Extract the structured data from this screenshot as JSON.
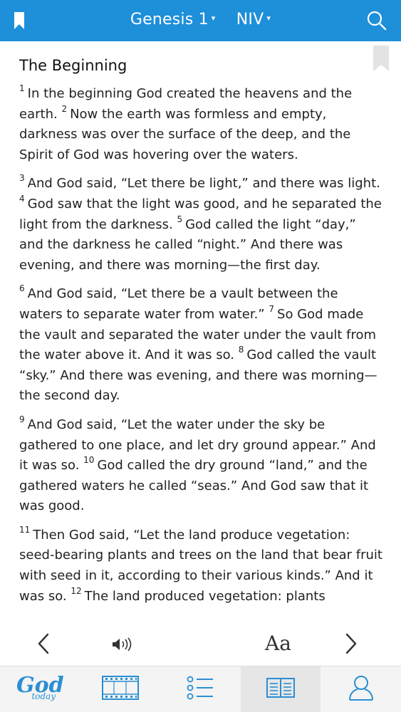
{
  "header": {
    "book": "Genesis 1",
    "version": "NIV",
    "book_caret": "▾",
    "version_caret": "▾",
    "bookmark_icon": "bookmark-icon",
    "search_icon": "search-icon",
    "bar_color": "#1e8fd9"
  },
  "reader": {
    "heading": "The Beginning",
    "paragraphs": [
      {
        "verses": [
          {
            "num": "1",
            "text": "In the beginning God created the heavens and the earth."
          },
          {
            "num": "2",
            "text": "Now the earth was formless and empty, darkness was over the surface of the deep, and the Spirit of God was hovering over the waters."
          }
        ]
      },
      {
        "verses": [
          {
            "num": "3",
            "text": "And God said, “Let there be light,” and there was light."
          },
          {
            "num": "4",
            "text": "God saw that the light was good, and he separated the light from the darkness."
          },
          {
            "num": "5",
            "text": "God called the light “day,” and the darkness he called “night.” And there was evening, and there was morning—the first day."
          }
        ]
      },
      {
        "verses": [
          {
            "num": "6",
            "text": "And God said, “Let there be a vault between the waters to separate water from water.”"
          },
          {
            "num": "7",
            "text": "So God made the vault and separated the water under the vault from the water above it. And it was so."
          },
          {
            "num": "8",
            "text": "God called the vault “sky.” And there was evening, and there was morning—the second day."
          }
        ]
      },
      {
        "verses": [
          {
            "num": "9",
            "text": "And God said, “Let the water under the sky be gathered to one place, and let dry ground appear.” And it was so."
          },
          {
            "num": "10",
            "text": "God called the dry ground “land,” and the gathered waters he called “seas.” And God saw that it was good."
          }
        ]
      },
      {
        "verses": [
          {
            "num": "11",
            "text": "Then God said, “Let the land produce vegetation: seed-bearing plants and trees on the land that bear fruit with seed in it, according to their various kinds.” And it was so."
          },
          {
            "num": "12",
            "text": "The land produced vegetation: plants"
          }
        ]
      }
    ]
  },
  "controls": {
    "prev_icon": "chevron-left-icon",
    "audio_icon": "speaker-icon",
    "font_size_label": "Aa",
    "next_icon": "chevron-right-icon"
  },
  "tabs": {
    "logo_word": "God",
    "logo_sub": "today",
    "items": [
      {
        "icon": "god-today-logo",
        "active": false
      },
      {
        "icon": "film-icon",
        "active": false
      },
      {
        "icon": "list-icon",
        "active": false
      },
      {
        "icon": "book-icon",
        "active": true
      },
      {
        "icon": "profile-icon",
        "active": false
      }
    ],
    "accent": "#2a8fd3"
  }
}
